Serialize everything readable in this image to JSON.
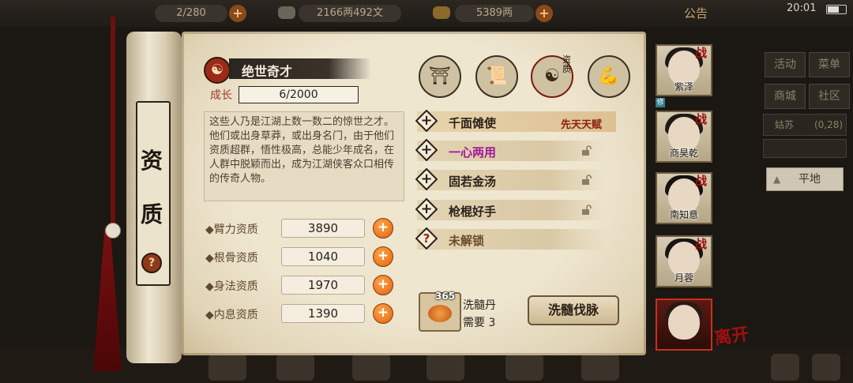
{
  "topbar": {
    "storage": "2/280",
    "money": "2166两492文",
    "gold": "5389两",
    "notice": "公告",
    "time": "20:01"
  },
  "side": {
    "buttons": [
      "活动",
      "菜单",
      "商城",
      "社区"
    ],
    "location": "姑苏",
    "coords": "(0,28)",
    "terrain": "平地"
  },
  "scroll": {
    "title_1": "资",
    "title_2": "质",
    "help": "?"
  },
  "talent": {
    "name": "绝世奇才",
    "growth_label": "成长",
    "growth_value": "6/2000",
    "description": "这些人乃是江湖上数一数二的惊世之才。他们或出身草莽，或出身名门，由于他们资质超群，悟性极高，总能少年成名，在人群中脱颖而出，成为江湖侠客众口相传的传奇人物。"
  },
  "attributes": [
    {
      "label": "◆臂力资质",
      "value": "3890"
    },
    {
      "label": "◆根骨资质",
      "value": "1040"
    },
    {
      "label": "◆身法资质",
      "value": "1970"
    },
    {
      "label": "◆内息资质",
      "value": "1390"
    }
  ],
  "tabs": {
    "zizhi_tag": "资质"
  },
  "skills": [
    {
      "name": "千面傩使",
      "note": "先天天赋",
      "color": "#2b231a",
      "locked": false,
      "unknown": false
    },
    {
      "name": "一心两用",
      "note": "",
      "color": "#a0189a",
      "locked": true,
      "unknown": false
    },
    {
      "name": "固若金汤",
      "note": "",
      "color": "#2b231a",
      "locked": true,
      "unknown": false
    },
    {
      "name": "枪棍好手",
      "note": "",
      "color": "#2b231a",
      "locked": true,
      "unknown": false
    },
    {
      "name": "未解锁",
      "note": "",
      "color": "#6b4a2a",
      "locked": false,
      "unknown": true
    }
  ],
  "wash": {
    "count": "365",
    "item_name": "洗髓丹",
    "need_label": "需要",
    "need_value": "3",
    "button": "洗髓伐脉"
  },
  "portraits": [
    {
      "name": "紫泽",
      "tag": "战"
    },
    {
      "name": "商昊乾",
      "tag": "战"
    },
    {
      "name": "南知意",
      "tag": "战"
    },
    {
      "name": "月蓉",
      "tag": "战"
    }
  ],
  "leave_tag": "离开"
}
